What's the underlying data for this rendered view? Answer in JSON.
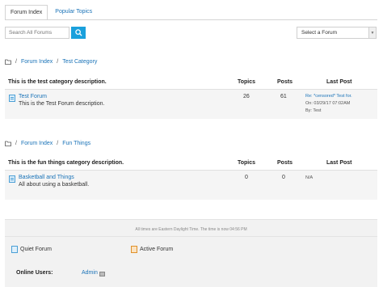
{
  "tabs": [
    {
      "label": "Forum Index",
      "active": true
    },
    {
      "label": "Popular Topics",
      "active": false
    }
  ],
  "search": {
    "placeholder": "Search All Forums",
    "icon": "search-icon"
  },
  "forum_select": {
    "value": "Select a Forum"
  },
  "categories": [
    {
      "breadcrumb": [
        "Forum Index",
        "Test Category"
      ],
      "description": "This is the test category description.",
      "columns": {
        "topics": "Topics",
        "posts": "Posts",
        "last_post": "Last Post"
      },
      "forum": {
        "name": "Test Forum",
        "description": "This is the Test Forum description.",
        "topics": "26",
        "posts": "61",
        "last_post_title": "Re: *censored* Test for.",
        "last_post_date": "On: 03/29/17 07:02AM",
        "last_post_by": "By: Test"
      }
    },
    {
      "breadcrumb": [
        "Forum Index",
        "Fun Things"
      ],
      "description": "This is the fun things category description.",
      "columns": {
        "topics": "Topics",
        "posts": "Posts",
        "last_post": "Last Post"
      },
      "forum": {
        "name": "Basketball and Things",
        "description": "All about using a basketball.",
        "topics": "0",
        "posts": "0",
        "last_post_title": "N/A"
      }
    }
  ],
  "footer": {
    "timezone": "All times are Eastern Daylight Time. The time is now 04:56 PM",
    "legend": {
      "quiet": "Quiet Forum",
      "active": "Active Forum"
    },
    "online_label": "Online Users:",
    "online_user": "Admin"
  },
  "colors": {
    "link": "#1a73b8",
    "search_button": "#1aa0dc",
    "quiet_icon": "#4a9fd6",
    "active_icon": "#e0912a"
  }
}
